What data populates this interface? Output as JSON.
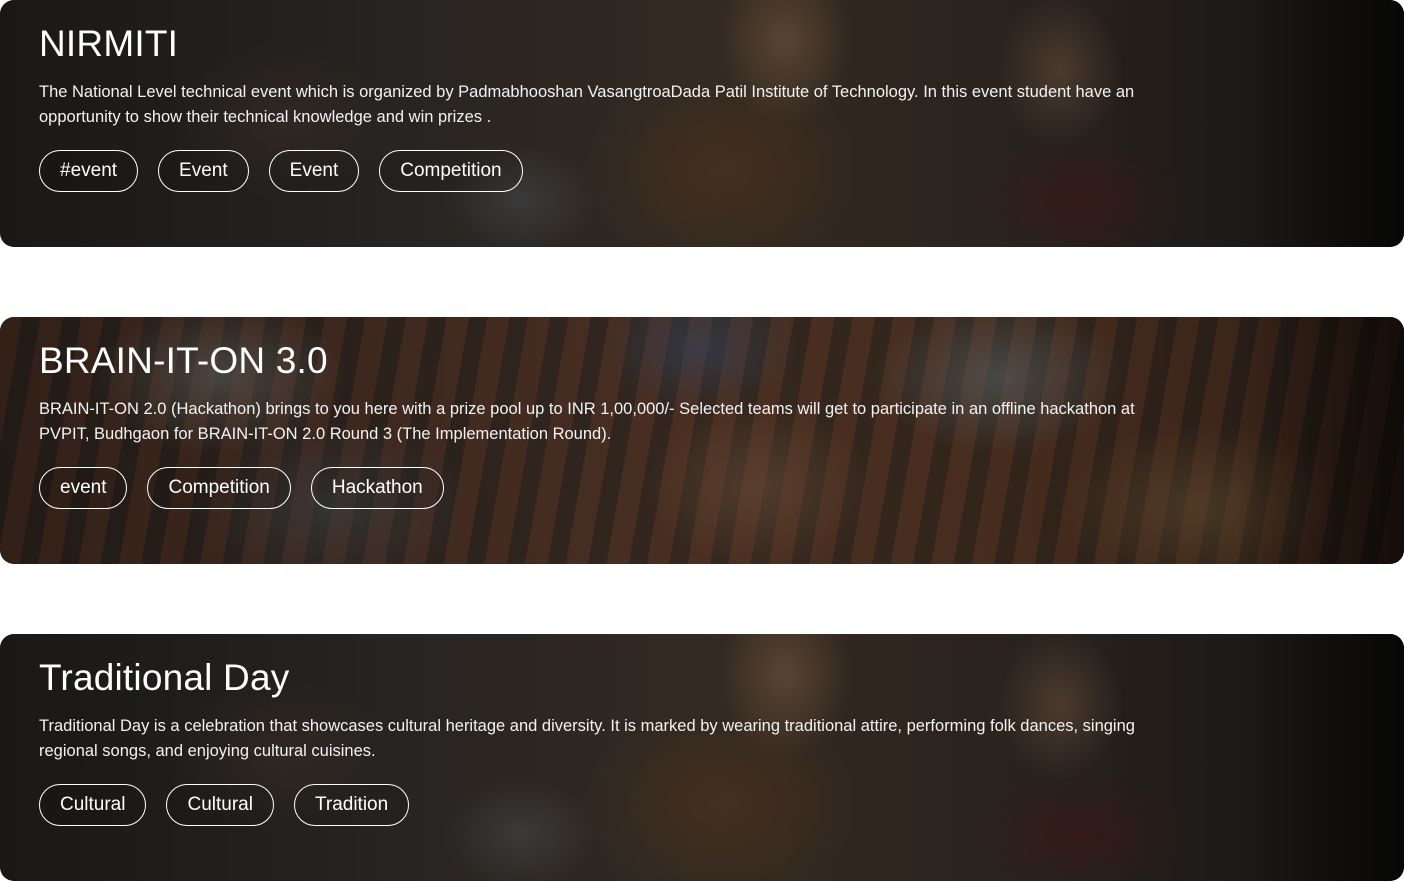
{
  "events": [
    {
      "title": "NIRMITI",
      "description": "The National Level technical event which is organized by Padmabhooshan VasangtroaDada Patil Institute of Technology. In this event student have an opportunity to show their technical knowledge and win prizes .",
      "tags": [
        "#event",
        "Event",
        "Event",
        "Competition"
      ]
    },
    {
      "title": "BRAIN-IT-ON 3.0",
      "description": "BRAIN-IT-ON 2.0 (Hackathon) brings to you here with a prize pool up to INR 1,00,000/- Selected teams will get to participate in an offline hackathon at PVPIT, Budhgaon for BRAIN-IT-ON 2.0 Round 3 (The Implementation Round).",
      "tags": [
        "event",
        "Competition",
        "Hackathon"
      ]
    },
    {
      "title": "Traditional Day",
      "description": "Traditional Day is a celebration that showcases cultural heritage and diversity. It is marked by wearing traditional attire, performing folk dances, singing regional songs, and enjoying cultural cuisines.",
      "tags": [
        "Cultural",
        "Cultural",
        "Tradition"
      ]
    }
  ]
}
